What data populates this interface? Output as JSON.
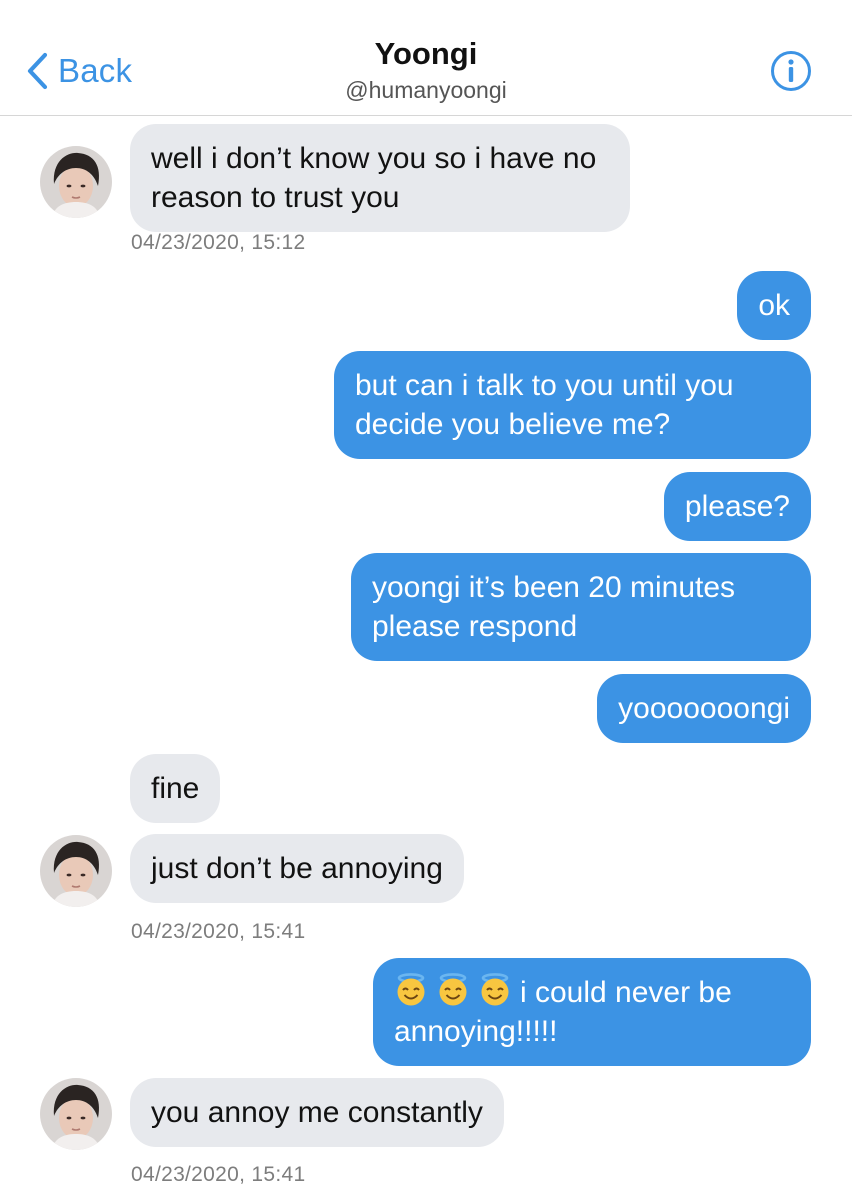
{
  "nav": {
    "back_label": "Back",
    "contact_name": "Yoongi",
    "contact_handle": "@humanyoongi",
    "info_icon": "info-circle-icon"
  },
  "colors": {
    "accent": "#3c93e4",
    "received_bubble": "#e7e9ed",
    "sent_bubble": "#3c93e4"
  },
  "messages": [
    {
      "from": "them",
      "text": "well i don’t know you so i have no reason to trust you"
    },
    {
      "from": "them",
      "timestamp": "04/23/2020, 15:12"
    },
    {
      "from": "me",
      "text": "ok"
    },
    {
      "from": "me",
      "text": "but can i talk to you until you decide you believe me?"
    },
    {
      "from": "me",
      "text": "please?"
    },
    {
      "from": "me",
      "text": "yoongi it’s been 20 minutes please respond"
    },
    {
      "from": "me",
      "text": "yooooooongi"
    },
    {
      "from": "them",
      "text": "fine"
    },
    {
      "from": "them",
      "text": "just don’t be annoying"
    },
    {
      "from": "them",
      "timestamp": "04/23/2020, 15:41"
    },
    {
      "from": "me",
      "emoji": [
        "smiling-face-with-halo",
        "smiling-face-with-halo",
        "smiling-face-with-halo"
      ],
      "text": "i could never be annoying!!!!!"
    },
    {
      "from": "them",
      "text": "you annoy me constantly"
    },
    {
      "from": "them",
      "timestamp": "04/23/2020, 15:41"
    }
  ]
}
